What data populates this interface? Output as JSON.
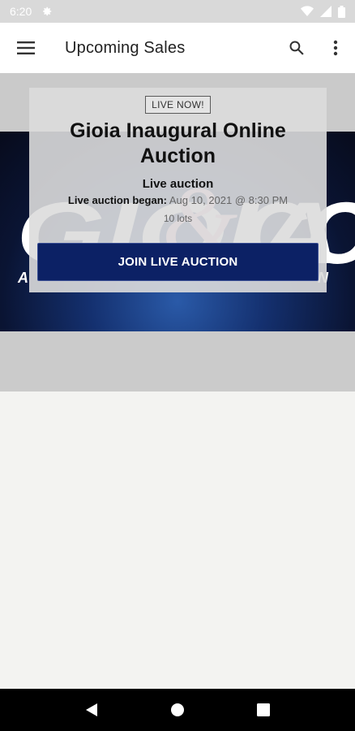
{
  "status_bar": {
    "time": "6:20",
    "icons": [
      "gear-icon",
      "wifi-icon",
      "signal-icon",
      "battery-icon"
    ]
  },
  "app_bar": {
    "title": "Upcoming Sales",
    "icons": [
      "hamburger-menu-icon",
      "search-icon",
      "more-vert-icon"
    ]
  },
  "sale_card": {
    "badge": "LIVE NOW!",
    "title": "Gioia Inaugural Online Auction",
    "type": "Live auction",
    "began_label": "Live auction began:",
    "began_value": "Aug 10, 2021 @ 8:30 PM",
    "lots": "10 lots",
    "join_label": "JOIN LIVE AUCTION"
  },
  "banner": {
    "logo_text": "GIOIA & CO",
    "colors": {
      "navy": "#0c2165",
      "pink": "#f2c4d6",
      "white": "#ffffff"
    }
  },
  "nav_bar": {
    "icons": [
      "back-icon",
      "home-icon",
      "recents-icon"
    ]
  }
}
